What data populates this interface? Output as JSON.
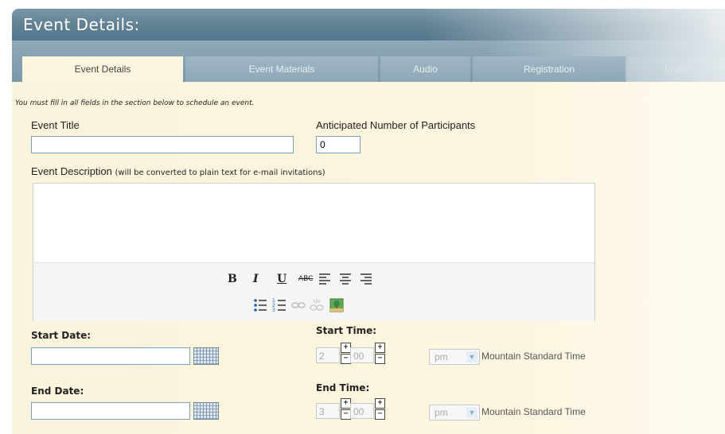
{
  "header": {
    "title": "Event Details:"
  },
  "tabs": [
    {
      "label": "Event Details"
    },
    {
      "label": "Event Materials"
    },
    {
      "label": "Audio"
    },
    {
      "label": "Registration"
    },
    {
      "label": "Invite"
    }
  ],
  "form": {
    "notice": "You must fill in all fields in the section below to schedule an event.",
    "event_title_label": "Event Title",
    "event_title_value": "",
    "participants_label": "Anticipated Number of Participants",
    "participants_value": "0",
    "description_label": "Event Description",
    "description_note": "(will be converted to plain text for e-mail invitations)",
    "start_date_label": "Start Date:",
    "start_time_label": "Start Time:",
    "end_date_label": "End Date:",
    "end_time_label": "End Time:",
    "start_hour": "2",
    "start_minute": "00",
    "start_ampm": "pm",
    "end_hour": "3",
    "end_minute": "00",
    "end_ampm": "pm",
    "timezone": "Mountain Standard Time"
  },
  "toolbar": {
    "bold": "B",
    "italic": "I",
    "underline": "U",
    "strike": "ABC"
  },
  "colors": {
    "titlebar": "#5f7f93",
    "tab": "#8ea7b6",
    "panel": "#fcf6e0"
  }
}
